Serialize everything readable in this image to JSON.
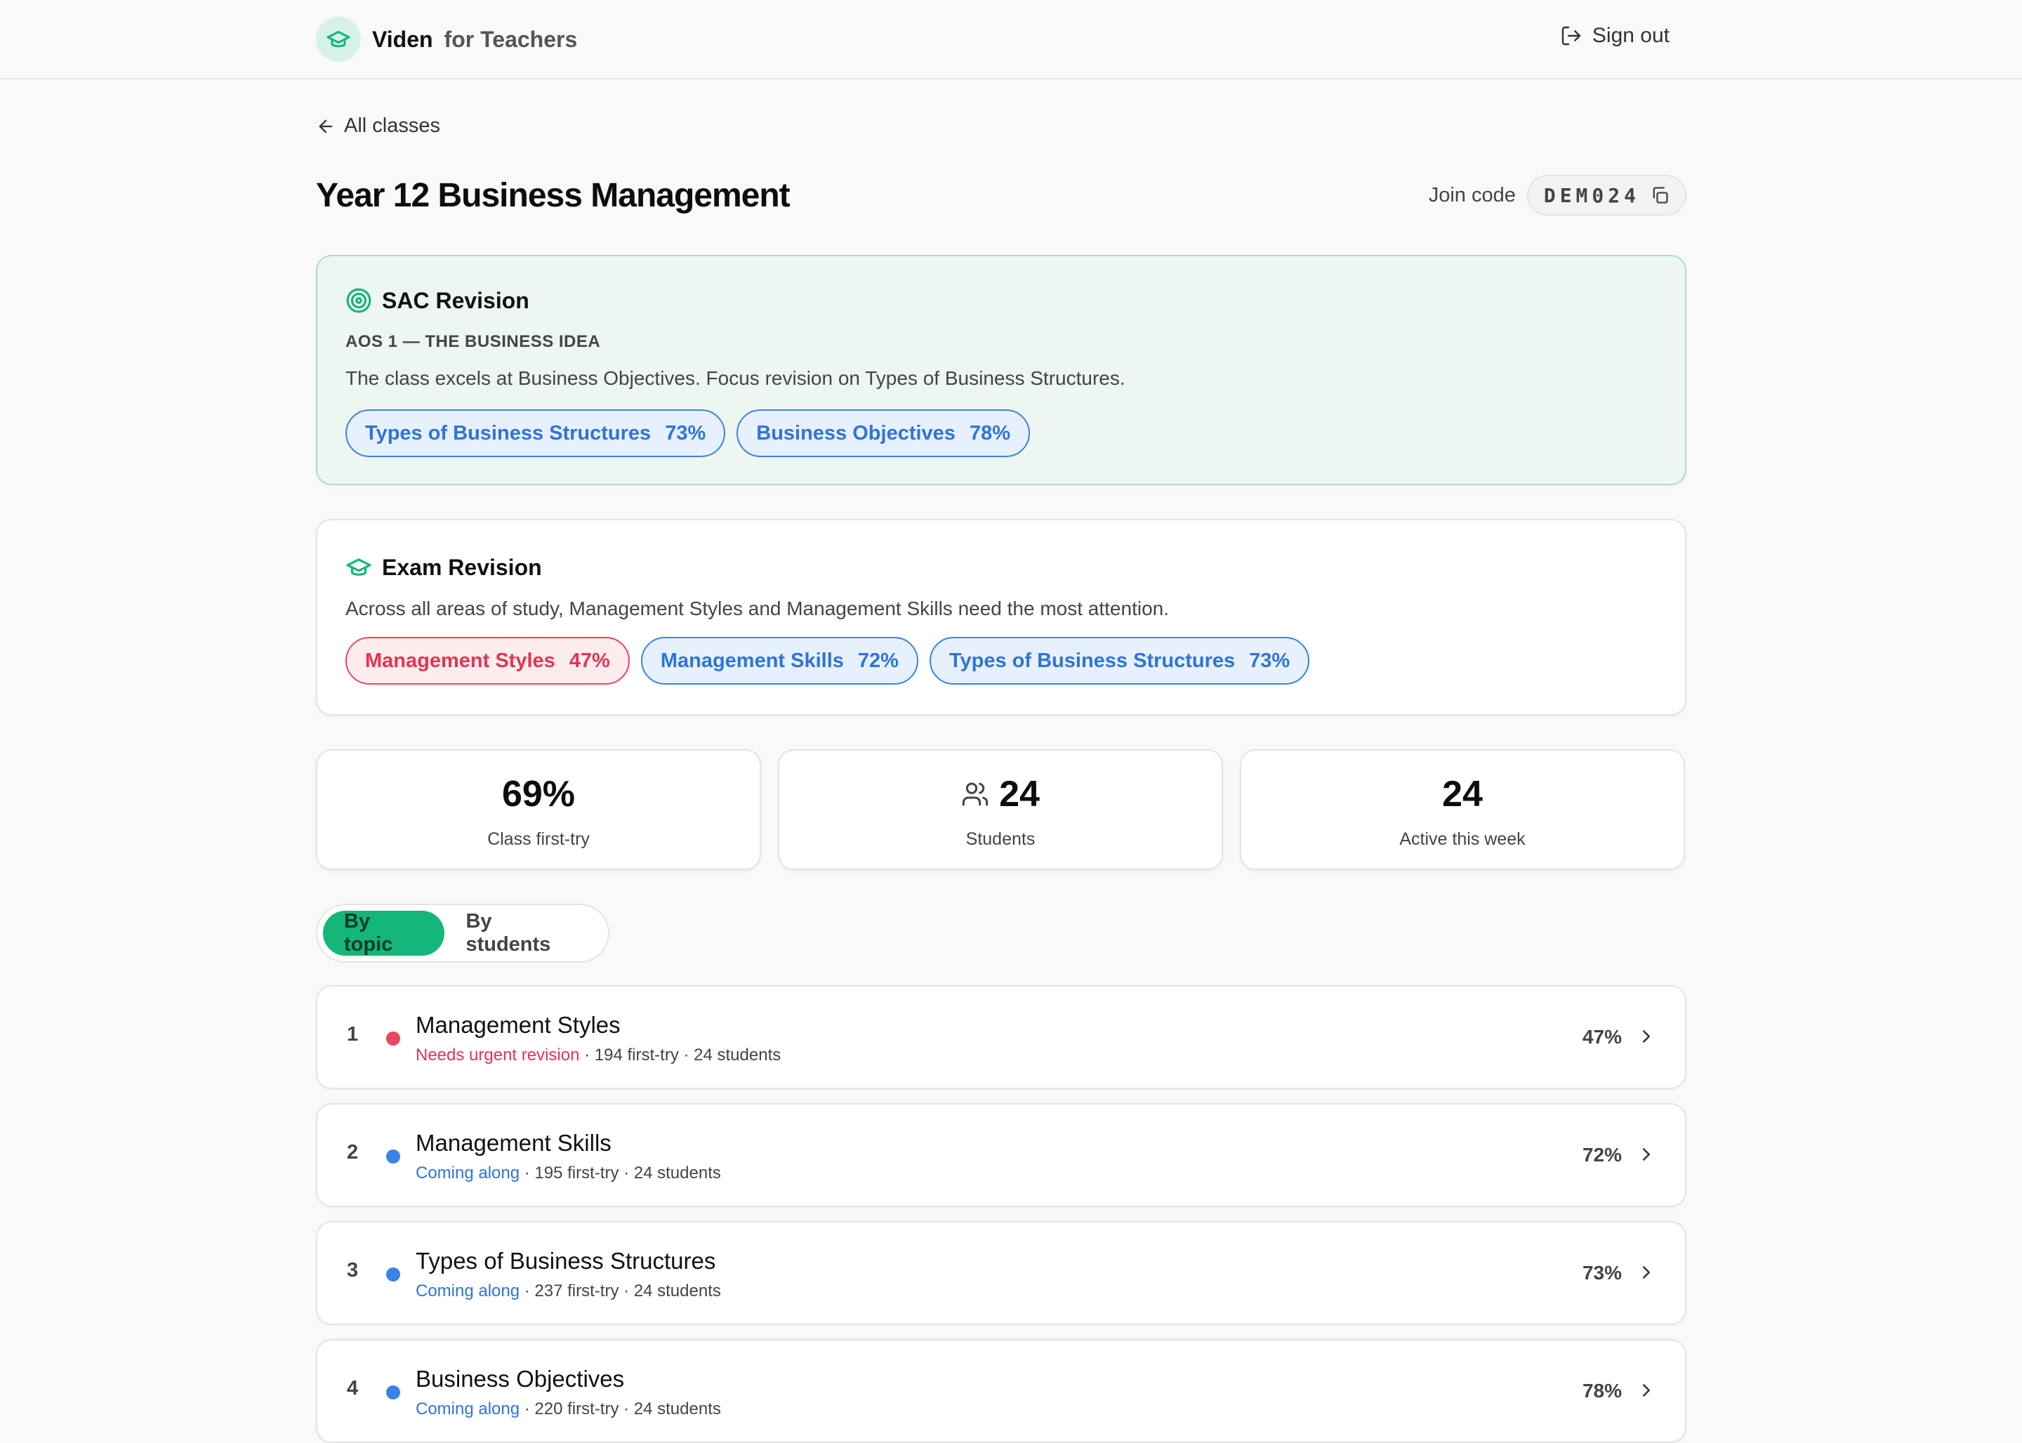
{
  "header": {
    "brand_name": "Viden",
    "brand_sub": "for Teachers",
    "sign_out": "Sign out"
  },
  "nav": {
    "back_label": "All classes"
  },
  "class": {
    "title": "Year 12 Business Management",
    "join_label": "Join code",
    "join_code": "DEM024"
  },
  "sac": {
    "title": "SAC Revision",
    "subtitle": "AOS 1 — THE BUSINESS IDEA",
    "description": "The class excels at Business Objectives. Focus revision on Types of Business Structures.",
    "pills": [
      {
        "label": "Types of Business Structures",
        "pct": "73%"
      },
      {
        "label": "Business Objectives",
        "pct": "78%"
      }
    ]
  },
  "exam": {
    "title": "Exam Revision",
    "description": "Across all areas of study, Management Styles and Management Skills need the most attention.",
    "pills": [
      {
        "label": "Management Styles",
        "pct": "47%"
      },
      {
        "label": "Management Skills",
        "pct": "72%"
      },
      {
        "label": "Types of Business Structures",
        "pct": "73%"
      }
    ]
  },
  "stats": [
    {
      "value": "69%",
      "label": "Class first-try"
    },
    {
      "value": "24",
      "label": "Students"
    },
    {
      "value": "24",
      "label": "Active this week"
    }
  ],
  "tabs": [
    {
      "label": "By topic"
    },
    {
      "label": "By students"
    }
  ],
  "topics": [
    {
      "num": "1",
      "title": "Management Styles",
      "status": "Needs urgent revision",
      "meta": " · 194 first-try · 24 students",
      "pct": "47%"
    },
    {
      "num": "2",
      "title": "Management Skills",
      "status": "Coming along",
      "meta": " · 195 first-try · 24 students",
      "pct": "72%"
    },
    {
      "num": "3",
      "title": "Types of Business Structures",
      "status": "Coming along",
      "meta": " · 237 first-try · 24 students",
      "pct": "73%"
    },
    {
      "num": "4",
      "title": "Business Objectives",
      "status": "Coming along",
      "meta": " · 220 first-try · 24 students",
      "pct": "78%"
    }
  ],
  "colors": {
    "accent": "#14b679",
    "urgent": "#e23552",
    "progress": "#2f74d8"
  }
}
